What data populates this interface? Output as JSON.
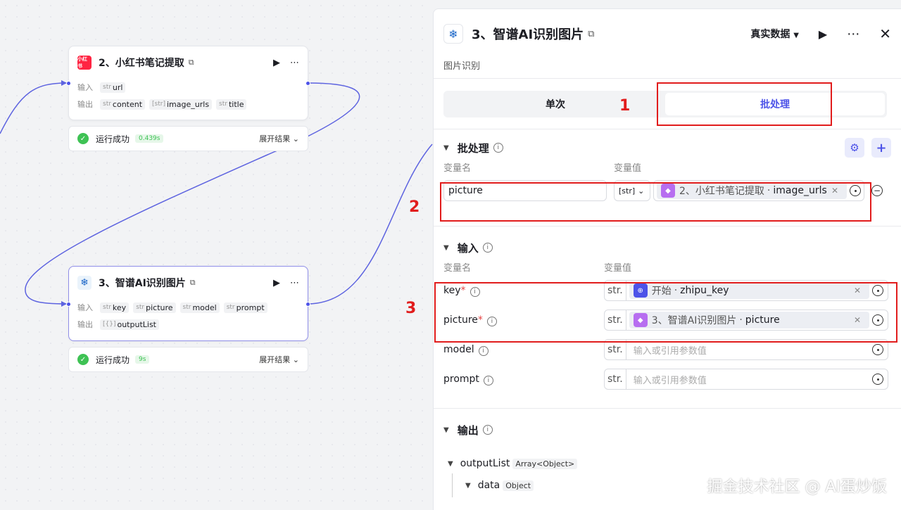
{
  "nodes": {
    "xhs": {
      "title": "2、小红书笔记提取",
      "logo_text": "小红书",
      "input_label": "输入",
      "output_label": "输出",
      "inputs": [
        {
          "type": "str",
          "name": "url"
        }
      ],
      "outputs": [
        {
          "type": "str",
          "name": "content"
        },
        {
          "type": "[str]",
          "name": "image_urls"
        },
        {
          "type": "str",
          "name": "title"
        }
      ],
      "status": "运行成功",
      "duration": "0.439s",
      "expand": "展开结果"
    },
    "zp": {
      "title": "3、智谱AI识别图片",
      "input_label": "输入",
      "output_label": "输出",
      "inputs": [
        {
          "type": "str",
          "name": "key"
        },
        {
          "type": "str",
          "name": "picture"
        },
        {
          "type": "str",
          "name": "model"
        },
        {
          "type": "str",
          "name": "prompt"
        }
      ],
      "outputs": [
        {
          "type": "[{}]",
          "name": "outputList"
        }
      ],
      "status": "运行成功",
      "duration": "9s",
      "expand": "展开结果"
    }
  },
  "panel": {
    "title": "3、智谱AI识别图片",
    "mode_select": "真实数据",
    "subtitle": "图片识别",
    "tabs": [
      "单次",
      "批处理"
    ],
    "batch": {
      "heading": "批处理",
      "col_name": "变量名",
      "col_value": "变量值",
      "var_name": "picture",
      "type": "[str]",
      "ref_node": "2、小红书笔记提取",
      "ref_var": "image_urls"
    },
    "input": {
      "heading": "输入",
      "col_name": "变量名",
      "col_value": "变量值",
      "rows": [
        {
          "name": "key",
          "required": "*",
          "type": "str.",
          "ref_node": "开始",
          "ref_var": "zhipu_key"
        },
        {
          "name": "picture",
          "required": "*",
          "type": "str.",
          "ref_node": "3、智谱AI识别图片",
          "ref_var": "picture"
        },
        {
          "name": "model",
          "type": "str.",
          "placeholder": "输入或引用参数值"
        },
        {
          "name": "prompt",
          "type": "str.",
          "placeholder": "输入或引用参数值"
        }
      ]
    },
    "output": {
      "heading": "输出",
      "tree": [
        {
          "name": "outputList",
          "type": "Array<Object>"
        },
        {
          "name": "data",
          "type": "Object"
        }
      ]
    }
  },
  "callouts": [
    "1",
    "2",
    "3"
  ],
  "watermark": "掘金技术社区 @ AI蛋炒饭",
  "colors": {
    "accent": "#4d53e8",
    "highlight": "#e11c1c",
    "success": "#3ec254"
  }
}
